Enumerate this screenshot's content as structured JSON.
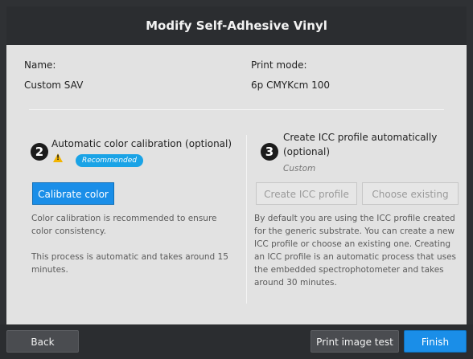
{
  "dialog": {
    "title": "Modify Self-Adhesive Vinyl"
  },
  "info": {
    "name_label": "Name:",
    "name_value": "Custom SAV",
    "print_mode_label": "Print mode:",
    "print_mode_value": "6p CMYKcm 100"
  },
  "calibration": {
    "step_number": "2",
    "title": "Automatic color calibration (optional)",
    "warning_icon": "warning-icon",
    "badge": "Recommended",
    "button_label": "Calibrate color",
    "paragraph1": "Color calibration is recommended to ensure color consistency.",
    "paragraph2": "This process is automatic and takes around 15 minutes."
  },
  "icc": {
    "step_number": "3",
    "title_line1": "Create ICC profile automatically",
    "title_line2": "(optional)",
    "subtitle": "Custom",
    "create_button": "Create ICC profile",
    "choose_button": "Choose existing",
    "paragraph": "By default you are using the ICC profile created for the generic substrate. You can create a new ICC profile or choose an existing one. Creating an ICC profile is an automatic process that uses the embedded spectrophotometer and takes around 30 minutes."
  },
  "footer": {
    "back": "Back",
    "print_image_test": "Print image test",
    "finish": "Finish"
  }
}
